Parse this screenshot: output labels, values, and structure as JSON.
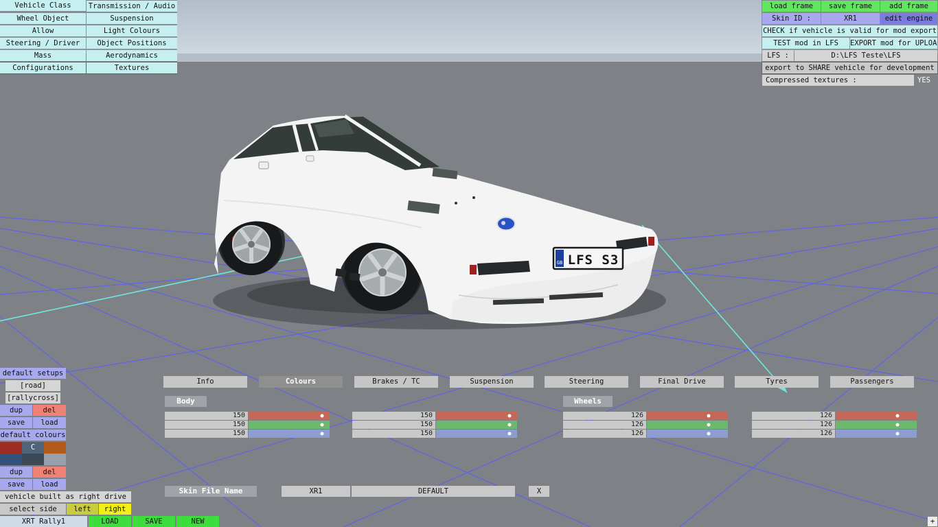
{
  "top_left_menu": {
    "col1": [
      "Vehicle Class",
      "Wheel Object",
      "Allow",
      "Steering / Driver",
      "Mass",
      "Configurations"
    ],
    "col2": [
      "Transmission / Audio",
      "Suspension",
      "Light Colours",
      "Object Positions",
      "Aerodynamics",
      "Textures"
    ]
  },
  "top_right": {
    "load_frame": "load frame",
    "save_frame": "save frame",
    "add_frame": "add frame",
    "skin_id_label": "Skin ID :",
    "skin_id_value": "XR1",
    "edit_engine": "edit engine",
    "check_valid": "CHECK if vehicle is valid for mod export",
    "test_mod": "TEST mod in LFS",
    "export_mod": "EXPORT mod for UPLOAD",
    "lfs_label": "LFS :",
    "lfs_path": "D:\\LFS Teste\\LFS",
    "share_export": "export to SHARE vehicle for development",
    "compressed_label": "Compressed textures :",
    "compressed_value": "YES"
  },
  "tabs": {
    "active": "Colours",
    "items": [
      "Info",
      "Colours",
      "Brakes / TC",
      "Suspension",
      "Steering",
      "Final Drive",
      "Tyres",
      "Passengers"
    ]
  },
  "colours": {
    "body_label": "Body",
    "wheels_label": "Wheels",
    "slider_max": 165,
    "body1": [
      150,
      150,
      150
    ],
    "body2": [
      150,
      150,
      150
    ],
    "wheels1": [
      126,
      126,
      126
    ],
    "wheels2": [
      126,
      126,
      126
    ],
    "channel_colors": {
      "red": "#c4695a",
      "green": "#6cb86c",
      "blue": "#8d9dd0"
    }
  },
  "skin_row": {
    "label": "Skin File Name",
    "car": "XR1",
    "skin": "DEFAULT",
    "clear": "X"
  },
  "left_panel": {
    "default_setups": "default setups",
    "setup_road": "[road]",
    "setup_rallycross": "[rallycross]",
    "dup": "dup",
    "del": "del",
    "save": "save",
    "load": "load",
    "default_colours": "default colours",
    "swatches": [
      {
        "color": "#9e2d26",
        "label": ""
      },
      {
        "color": "#50637a",
        "label": "C"
      },
      {
        "color": "#b25a1c",
        "label": ""
      },
      {
        "color": "#34517d",
        "label": ""
      },
      {
        "color": "#3e4956",
        "label": ""
      },
      {
        "color": "#97a0ac",
        "label": ""
      }
    ],
    "right_drive": "vehicle built as right drive",
    "select_side": "select side",
    "side_left": "left",
    "side_right": "right",
    "vehicle_name": "XRT Rally1",
    "load_upper": "LOAD",
    "save_upper": "SAVE",
    "new_upper": "NEW"
  },
  "scene": {
    "license_plate": "LFS S3",
    "plate_country": "GB"
  },
  "corner": {
    "plus": "+"
  }
}
